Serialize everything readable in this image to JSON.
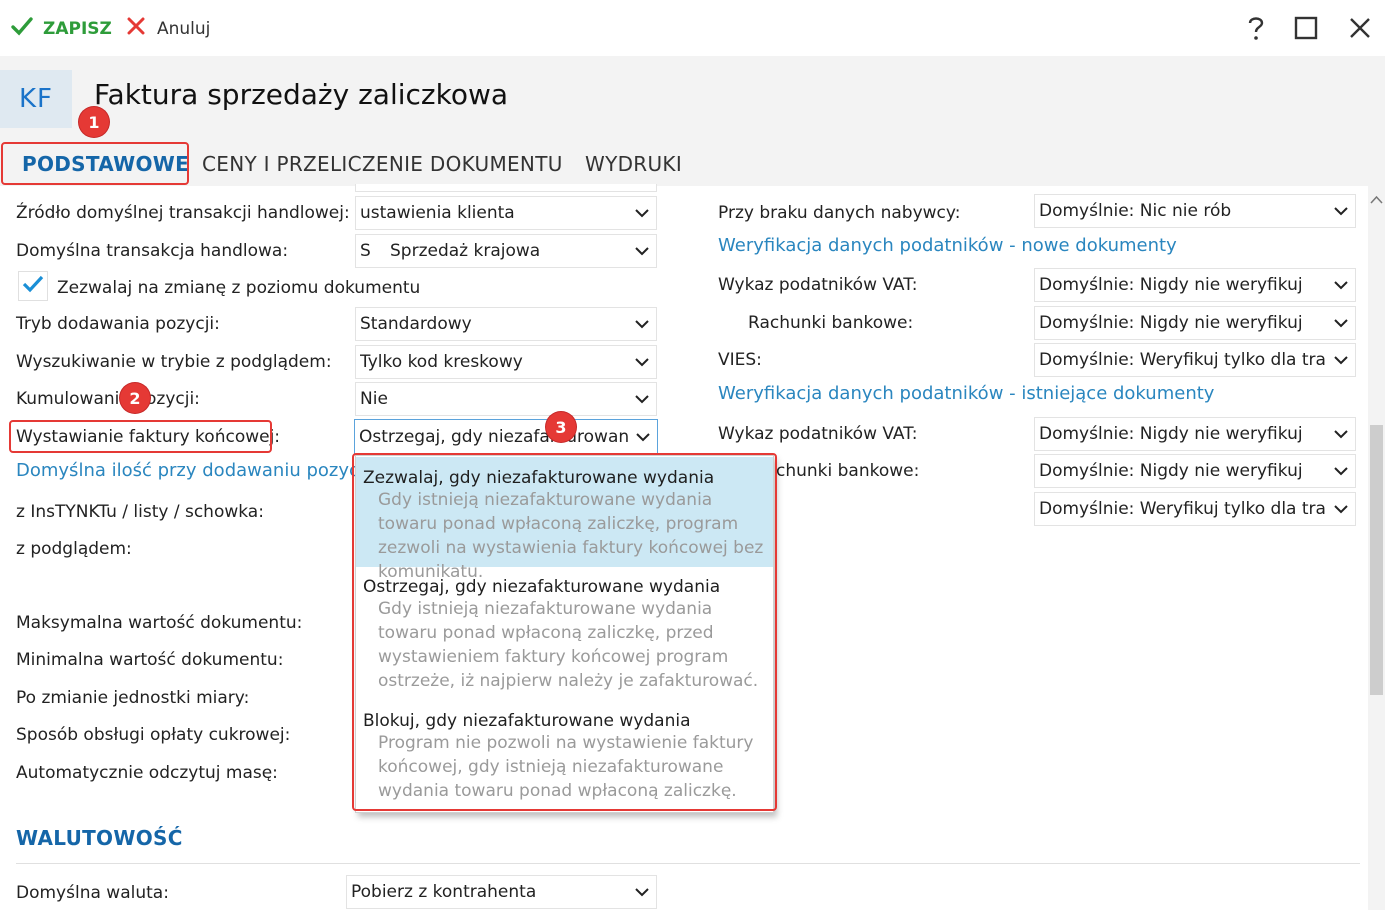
{
  "toolbar": {
    "save_label": "ZAPISZ",
    "cancel_label": "Anuluj"
  },
  "header": {
    "icon_text": "KF",
    "title": "Faktura sprzedaży zaliczkowa"
  },
  "tabs": [
    {
      "label": "PODSTAWOWE"
    },
    {
      "label": "CENY I PRZELICZENIE DOKUMENTU"
    },
    {
      "label": "WYDRUKI"
    }
  ],
  "badges": [
    "1",
    "2",
    "3"
  ],
  "left": {
    "source_label": "Źródło domyślnej transakcji handlowej:",
    "source_value": "ustawienia klienta",
    "trans_label": "Domyślna transakcja handlowa:",
    "trans_code": "S",
    "trans_value": "Sprzedaż krajowa",
    "allow_change_label": "Zezwalaj na zmianę z poziomu dokumentu",
    "add_mode_label": "Tryb dodawania pozycji:",
    "add_mode_value": "Standardowy",
    "search_label": "Wyszukiwanie w trybie z podglądem:",
    "search_value": "Tylko kod kreskowy",
    "cumul_label": "Kumulowanie pozycji:",
    "cumul_value": "Nie",
    "final_label": "Wystawianie faktury końcowej:",
    "final_value": "Ostrzegaj, gdy niezafakturowan...",
    "qty_link": "Domyślna ilość przy dodawaniu pozycji",
    "instynkt_label": "z InsTYNKTu / listy / schowka:",
    "preview_label": "z podglądem:",
    "max_label": "Maksymalna wartość dokumentu:",
    "min_label": "Minimalna wartość dokumentu:",
    "unit_label": "Po zmianie jednostki miary:",
    "sugar_label": "Sposób obsługi opłaty cukrowej:",
    "mass_label": "Automatycznie odczytuj masę:"
  },
  "right": {
    "nodata_label": "Przy braku danych nabywcy:",
    "nodata_value": "Domyślnie: Nic nie rób",
    "new_docs_link": "Weryfikacja danych podatników - nowe dokumenty",
    "vat1_label": "Wykaz podatników VAT:",
    "vat1_value": "Domyślnie: Nigdy nie weryfikuj",
    "bank1_label": "Rachunki bankowe:",
    "bank1_value": "Domyślnie: Nigdy nie weryfikuj",
    "vies1_label": "VIES:",
    "vies1_value": "Domyślnie: Weryfikuj tylko dla transa",
    "existing_link": "Weryfikacja danych podatników - istniejące dokumenty",
    "vat2_label": "Wykaz podatników VAT:",
    "vat2_value": "Domyślnie: Nigdy nie weryfikuj",
    "bank2_label": "chunki bankowe:",
    "bank2_value": "Domyślnie: Nigdy nie weryfikuj",
    "vies2_value": "Domyślnie: Weryfikuj tylko dla transa"
  },
  "dropdown": {
    "options": [
      {
        "title": "Zezwalaj, gdy niezafakturowane wydania",
        "desc": "Gdy istnieją niezafakturowane wydania towaru ponad wpłaconą zaliczkę, program zezwoli na wystawienia faktury końcowej bez komunikatu."
      },
      {
        "title": "Ostrzegaj, gdy niezafakturowane wydania",
        "desc": "Gdy istnieją niezafakturowane wydania towaru ponad wpłaconą zaliczkę, przed wystawieniem faktury końcowej program ostrzeże, iż najpierw należy je zafakturować."
      },
      {
        "title": "Blokuj, gdy niezafakturowane wydania",
        "desc": "Program nie pozwoli na wystawienie faktury końcowej, gdy istnieją niezafakturowane wydania towaru ponad wpłaconą zaliczkę."
      }
    ]
  },
  "currency": {
    "section": "WALUTOWOŚĆ",
    "label": "Domyślna waluta:",
    "value": "Pobierz z kontrahenta"
  },
  "colors": {
    "accent": "#1566a8",
    "link": "#2a86bf",
    "badge": "#e53935",
    "highlight": "#cce8f4"
  }
}
